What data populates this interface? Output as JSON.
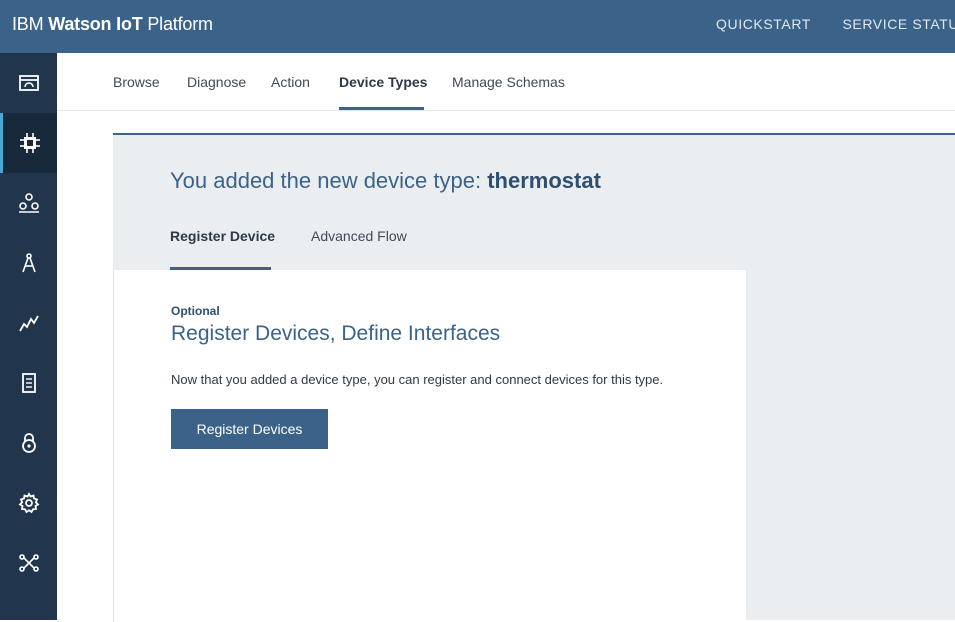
{
  "header": {
    "brand_prefix": "IBM",
    "brand_bold": "Watson IoT",
    "brand_suffix": "Platform",
    "nav": [
      "QUICKSTART",
      "SERVICE STATUS"
    ]
  },
  "sidebar": {
    "items": [
      {
        "icon": "dashboard-icon"
      },
      {
        "icon": "chip-icon",
        "active": true
      },
      {
        "icon": "members-icon"
      },
      {
        "icon": "compass-icon"
      },
      {
        "icon": "usage-chart-icon"
      },
      {
        "icon": "document-icon"
      },
      {
        "icon": "lock-icon"
      },
      {
        "icon": "gear-icon"
      },
      {
        "icon": "connections-icon"
      }
    ]
  },
  "subnav": {
    "tabs": [
      "Browse",
      "Diagnose",
      "Action",
      "Device Types",
      "Manage Schemas"
    ],
    "active": "Device Types"
  },
  "panel": {
    "title_prefix": "You added the new device type:",
    "title_device": "thermostat",
    "tabs": [
      "Register Device",
      "Advanced Flow"
    ],
    "active_tab": "Register Device",
    "card": {
      "eyebrow": "Optional",
      "title": "Register Devices, Define Interfaces",
      "description": "Now that you added a device type, you can register and connect devices for this type.",
      "button_label": "Register Devices"
    }
  },
  "colors": {
    "header_bg": "#3b6288",
    "sidebar_bg": "#21364d",
    "accent": "#3b6288",
    "panel_bg": "#ebeef1"
  }
}
